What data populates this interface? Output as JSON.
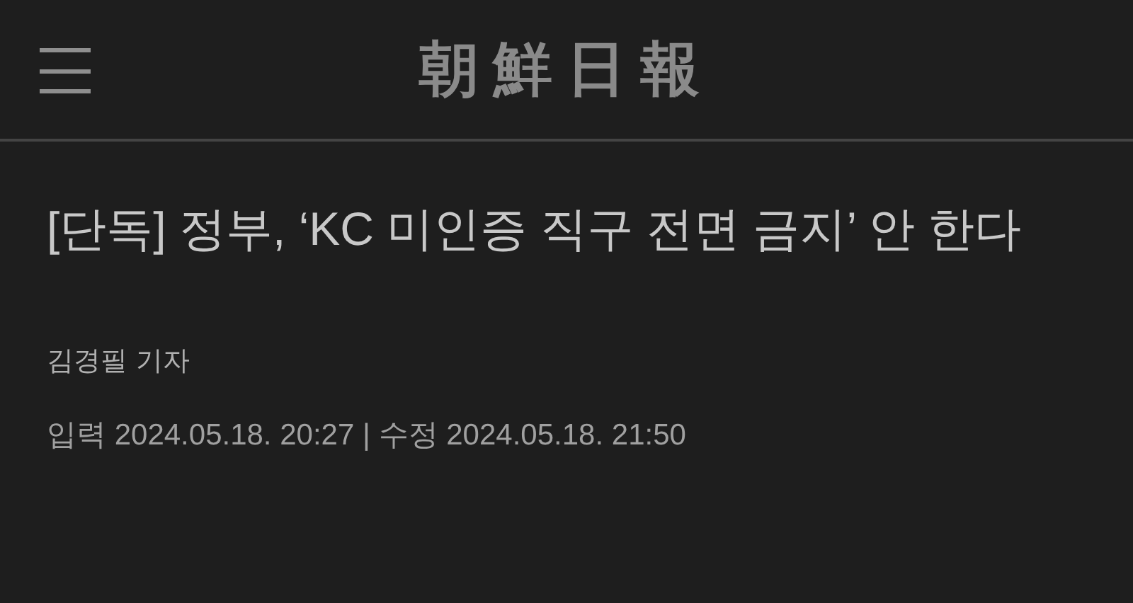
{
  "header": {
    "logo": "朝鮮日報"
  },
  "article": {
    "headline": "[단독] 정부, ‘KC 미인증 직구 전면 금지’ 안 한다",
    "byline": "김경필 기자",
    "dateline": "입력 2024.05.18. 20:27 | 수정 2024.05.18. 21:50"
  }
}
